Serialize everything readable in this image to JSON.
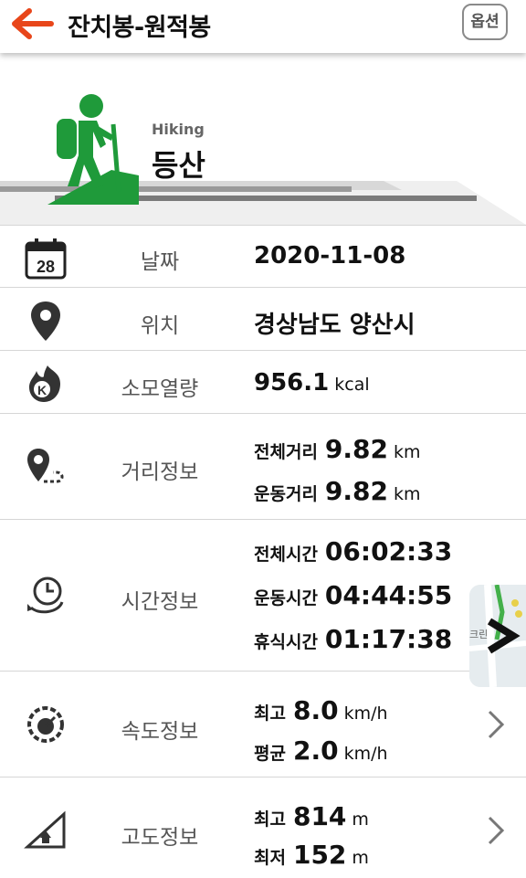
{
  "header": {
    "title": "잔치봉-원적봉",
    "options_label": "옵션"
  },
  "activity": {
    "name_en": "Hiking",
    "name_ko": "등산"
  },
  "date": {
    "label": "날짜",
    "value": "2020-11-08",
    "calendar_day": "28"
  },
  "location": {
    "label": "위치",
    "value": "경상남도 양산시"
  },
  "calories": {
    "label": "소모열량",
    "value": "956.1",
    "unit": "kcal"
  },
  "distance": {
    "label": "거리정보",
    "items": [
      {
        "key": "전체거리",
        "value": "9.82",
        "unit": "km"
      },
      {
        "key": "운동거리",
        "value": "9.82",
        "unit": "km"
      }
    ]
  },
  "time": {
    "label": "시간정보",
    "items": [
      {
        "key": "전체시간",
        "value": "06:02:33"
      },
      {
        "key": "운동시간",
        "value": "04:44:55"
      },
      {
        "key": "휴식시간",
        "value": "01:17:38"
      }
    ]
  },
  "speed": {
    "label": "속도정보",
    "items": [
      {
        "key": "최고",
        "value": "8.0",
        "unit": "km/h"
      },
      {
        "key": "평균",
        "value": "2.0",
        "unit": "km/h"
      }
    ]
  },
  "altitude": {
    "label": "고도정보",
    "items": [
      {
        "key": "최고",
        "value": "814",
        "unit": "m"
      },
      {
        "key": "최저",
        "value": "152",
        "unit": "m"
      }
    ]
  },
  "map_thumb": {
    "text": "크린"
  },
  "colors": {
    "accent": "#e8461a",
    "hiker": "#1f9a3a"
  }
}
